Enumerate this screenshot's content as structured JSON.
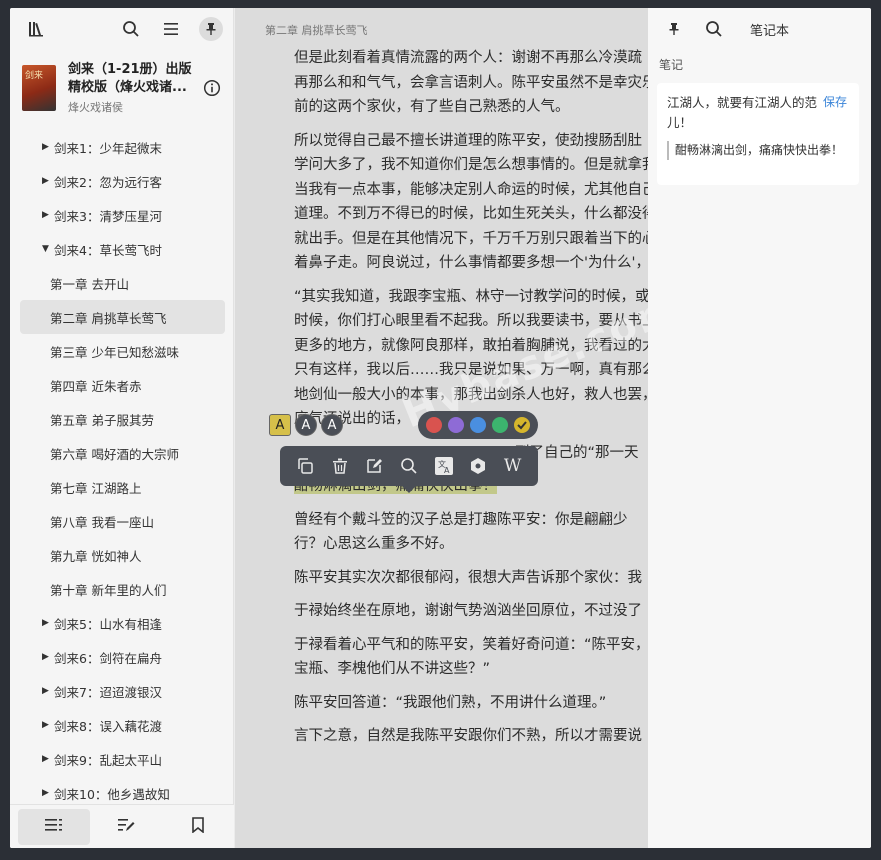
{
  "sidebar": {
    "book": {
      "cover_text": "剑来",
      "title": "剑来（1-21册）出版精校版（烽火戏诸...",
      "title_line1": "剑来（1-21册）出版",
      "title_line2": "精校版（烽火戏诸...",
      "author": "烽火戏诸侯"
    },
    "toc": [
      {
        "label": "剑来1：少年起微末",
        "level": 0,
        "expanded": false
      },
      {
        "label": "剑来2：忽为远行客",
        "level": 0,
        "expanded": false
      },
      {
        "label": "剑来3：清梦压星河",
        "level": 0,
        "expanded": false
      },
      {
        "label": "剑来4：草长莺飞时",
        "level": 0,
        "expanded": true
      },
      {
        "label": "第一章 去开山",
        "level": 1
      },
      {
        "label": "第二章 肩挑草长莺飞",
        "level": 1,
        "active": true
      },
      {
        "label": "第三章 少年已知愁滋味",
        "level": 1
      },
      {
        "label": "第四章 近朱者赤",
        "level": 1
      },
      {
        "label": "第五章 弟子服其劳",
        "level": 1
      },
      {
        "label": "第六章 喝好酒的大宗师",
        "level": 1
      },
      {
        "label": "第七章 江湖路上",
        "level": 1
      },
      {
        "label": "第八章 我看一座山",
        "level": 1
      },
      {
        "label": "第九章 恍如神人",
        "level": 1
      },
      {
        "label": "第十章 新年里的人们",
        "level": 1
      },
      {
        "label": "剑来5：山水有相逢",
        "level": 0,
        "expanded": false
      },
      {
        "label": "剑来6：剑符在扁舟",
        "level": 0,
        "expanded": false
      },
      {
        "label": "剑来7：迢迢渡银汉",
        "level": 0,
        "expanded": false
      },
      {
        "label": "剑来8：误入藕花渡",
        "level": 0,
        "expanded": false
      },
      {
        "label": "剑来9：乱起太平山",
        "level": 0,
        "expanded": false
      },
      {
        "label": "剑来10：他乡遇故知",
        "level": 0,
        "expanded": false
      }
    ]
  },
  "reader": {
    "chapter_header": "第二章 肩挑草长莺飞",
    "paragraphs": [
      [
        "但是此刻看着真情流露的两个人：谢谢不再那么冷漠疏",
        "再那么和和气气，会拿言语刺人。陈平安虽然不是幸灾乐祸",
        "前的这两个家伙，有了些自己熟悉的人气。"
      ],
      [
        "所以觉得自己最不擅长讲道理的陈平安，使劲搜肠刮肚",
        "学问大多了，我不知道你们是怎么想事情的。但是就拿我自",
        "当我有一点本事，能够决定别人命运的时候，尤其他自己觉",
        "道理。不到万不得已的时候，比如生死关头，什么都没得谈",
        "就出手。但是在其他情况下，千万千万别只跟着当下的心思",
        "着鼻子走。阿良说过，什么事情都要多想一个'为什么'，我觉"
      ],
      [
        "“其实我知道，我跟李宝瓶、林守一讨教学问的时候，或",
        "时候，你们打心眼里看不起我。所以我要读书，要从书上学",
        "更多的地方，就像阿良那样，敢拍着胸脯说，我看过的大江",
        "只有这样，我以后……我只是说如果、万一啊，真有那么一天",
        "地剑仙一般大小的本事，那我出剑杀人也好，救人也罢，一",
        "底气还说出的话，"
      ],
      [
        "到了自己的“那一天"
      ],
      [
        "酣畅淋漓出剑，痛痛快快出拳！"
      ],
      [
        "曾经有个戴斗笠的汉子总是打趣陈平安：你是翩翩少",
        "行？心思这么重多不好。"
      ],
      [
        "陈平安其实次次都很郁闷，很想大声告诉那个家伙：我"
      ],
      [
        "于禄始终坐在原地，谢谢气势汹汹坐回原位，不过没了"
      ],
      [
        "于禄看着心平气和的陈平安，笑着好奇问道：“陈平安，",
        "宝瓶、李槐他们从不讲这些？”"
      ],
      [
        "陈平安回答道：“我跟他们熟，不用讲什么道理。”"
      ],
      [
        "言下之意，自然是我陈平安跟你们不熟，所以才需要说"
      ]
    ],
    "highlight_styles": [
      "A",
      "A",
      "A"
    ],
    "highlight_colors": [
      "#d9534f",
      "#8e6bd6",
      "#4a8fe0",
      "#3cb46e",
      "#d6b62c"
    ],
    "actions": [
      "copy-icon",
      "delete-icon",
      "edit-icon",
      "search-icon",
      "translate-icon",
      "dictionary-icon",
      "wikipedia-icon"
    ],
    "wiki_label": "W",
    "watermark": "Hybase.com"
  },
  "notes": {
    "title": "笔记本",
    "section": "笔记",
    "card": {
      "text": "江湖人，就要有江湖人的范儿！",
      "save_label": "保存",
      "quote": "酣畅淋漓出剑，痛痛快快出拳！"
    }
  }
}
